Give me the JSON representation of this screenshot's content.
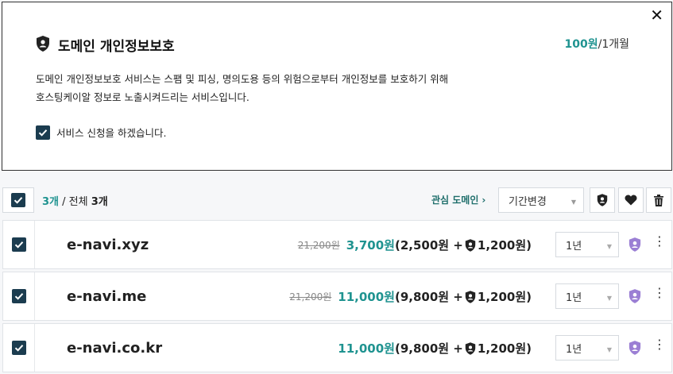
{
  "panel": {
    "title": "도메인 개인정보보호",
    "price_amount": "100원",
    "price_period": "/1개월",
    "desc_line1": "도메인 개인정보보호 서비스는 스팸 및 피싱, 명의도용 등의 위험으로부터 개인정보를 보호하기 위해",
    "desc_line2": "호스팅케이알 정보로 노출시켜드리는 서비스입니다.",
    "agree_label": "서비스 신청을 하겠습니다.",
    "close_icon": "close-icon",
    "shield_icon": "shield-person-icon"
  },
  "toolbar": {
    "selected": "3개",
    "separator": " / 전체 ",
    "total": "3개",
    "favorites_label": "관심 도메인",
    "period_label": "기간변경",
    "icons": [
      "shield-person-icon",
      "heart-icon",
      "trash-icon"
    ]
  },
  "rows": [
    {
      "domain": "e-navi.xyz",
      "old_price": "21,200원",
      "total": "3,700원",
      "breakdown_pre": "(2,500원 + ",
      "breakdown_post": "1,200원)",
      "term": "1년"
    },
    {
      "domain": "e-navi.me",
      "old_price": "21,200원",
      "total": "11,000원",
      "breakdown_pre": "(9,800원 + ",
      "breakdown_post": "1,200원)",
      "term": "1년"
    },
    {
      "domain": "e-navi.co.kr",
      "old_price": "",
      "total": "11,000원",
      "breakdown_pre": "(9,800원 + ",
      "breakdown_post": "1,200원)",
      "term": "1년"
    }
  ],
  "colors": {
    "accent": "#1f9390",
    "checkbox": "#1b3c4f",
    "privacy_badge": "#9b7fd4"
  }
}
